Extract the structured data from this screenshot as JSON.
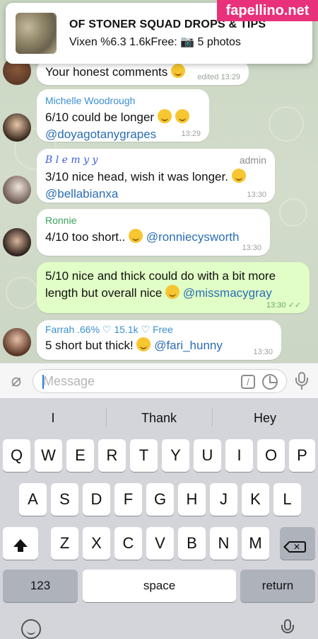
{
  "watermark": "fapellino.net",
  "pinned": {
    "title": "OF STONER SQUAD DROPS & TIPS",
    "subtitle": "Vixen %6.3 1.6kFree: 📷 5 photos"
  },
  "messages": [
    {
      "text": "Your honest comments",
      "time": "edited 13:29"
    },
    {
      "sender": "Michelle Woodrough",
      "sender_color": "#3a8fd1",
      "text": "6/10 could be longer",
      "mention": "@doyagotanygrapes",
      "time": "13:29"
    },
    {
      "sender": "B l e m y y",
      "sender_color": "#3b5fd6",
      "role": "admin",
      "text": "3/10 nice head, wish it was longer.",
      "mention": "@bellabianxa",
      "time": "13:30"
    },
    {
      "sender": "Ronnie",
      "sender_color": "#3aa55a",
      "text": "4/10 too short..",
      "mention": "@ronniecysworth",
      "time": "13:30"
    },
    {
      "text": "5/10 nice and thick could do with a bit more length but overall nice",
      "mention": "@missmacygray",
      "time": "13:30"
    },
    {
      "sender": "Farrah .66% ♡ 15.1k ♡ Free",
      "sender_color": "#3a8fd1",
      "text": "5 short but thick!",
      "mention": "@fari_hunny",
      "time": "13:30"
    }
  ],
  "input": {
    "placeholder": "Message"
  },
  "keyboard": {
    "suggestions": [
      "I",
      "Thank",
      "Hey"
    ],
    "row1": [
      "Q",
      "W",
      "E",
      "R",
      "T",
      "Y",
      "U",
      "I",
      "O",
      "P"
    ],
    "row2": [
      "A",
      "S",
      "D",
      "F",
      "G",
      "H",
      "J",
      "K",
      "L"
    ],
    "row3": [
      "Z",
      "X",
      "C",
      "V",
      "B",
      "N",
      "M"
    ],
    "numbers_label": "123",
    "space_label": "space",
    "return_label": "return"
  }
}
